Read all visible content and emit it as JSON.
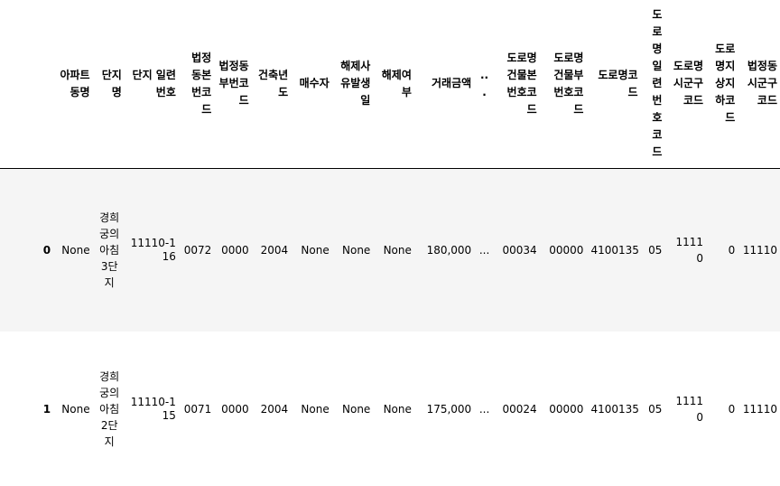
{
  "table": {
    "columns": [
      "",
      "아파트 동명",
      "단지명",
      "단지 일련번호",
      "법정동본번코드",
      "법정동부번코드",
      "건축년도",
      "매수자",
      "해제사유발생일",
      "해제여부",
      "거래금액",
      "...",
      "도로명건물본번호코드",
      "도로명건물부번호코드",
      "도로명코드",
      "도로명일련번호코드",
      "도로명시군구코드",
      "도로명지상지하코드",
      "법정동시군구코드"
    ],
    "rows": [
      {
        "index": "0",
        "cells": [
          "None",
          "경희궁의아침3단지",
          "11110-116",
          "0072",
          "0000",
          "2004",
          "None",
          "None",
          "None",
          "180,000",
          "...",
          "00034",
          "00000",
          "4100135",
          "05",
          "11110",
          "0",
          "11110"
        ]
      },
      {
        "index": "1",
        "cells": [
          "None",
          "경희궁의아침2단지",
          "11110-115",
          "0071",
          "0000",
          "2004",
          "None",
          "None",
          "None",
          "175,000",
          "...",
          "00024",
          "00000",
          "4100135",
          "05",
          "11110",
          "0",
          "11110"
        ]
      }
    ]
  }
}
